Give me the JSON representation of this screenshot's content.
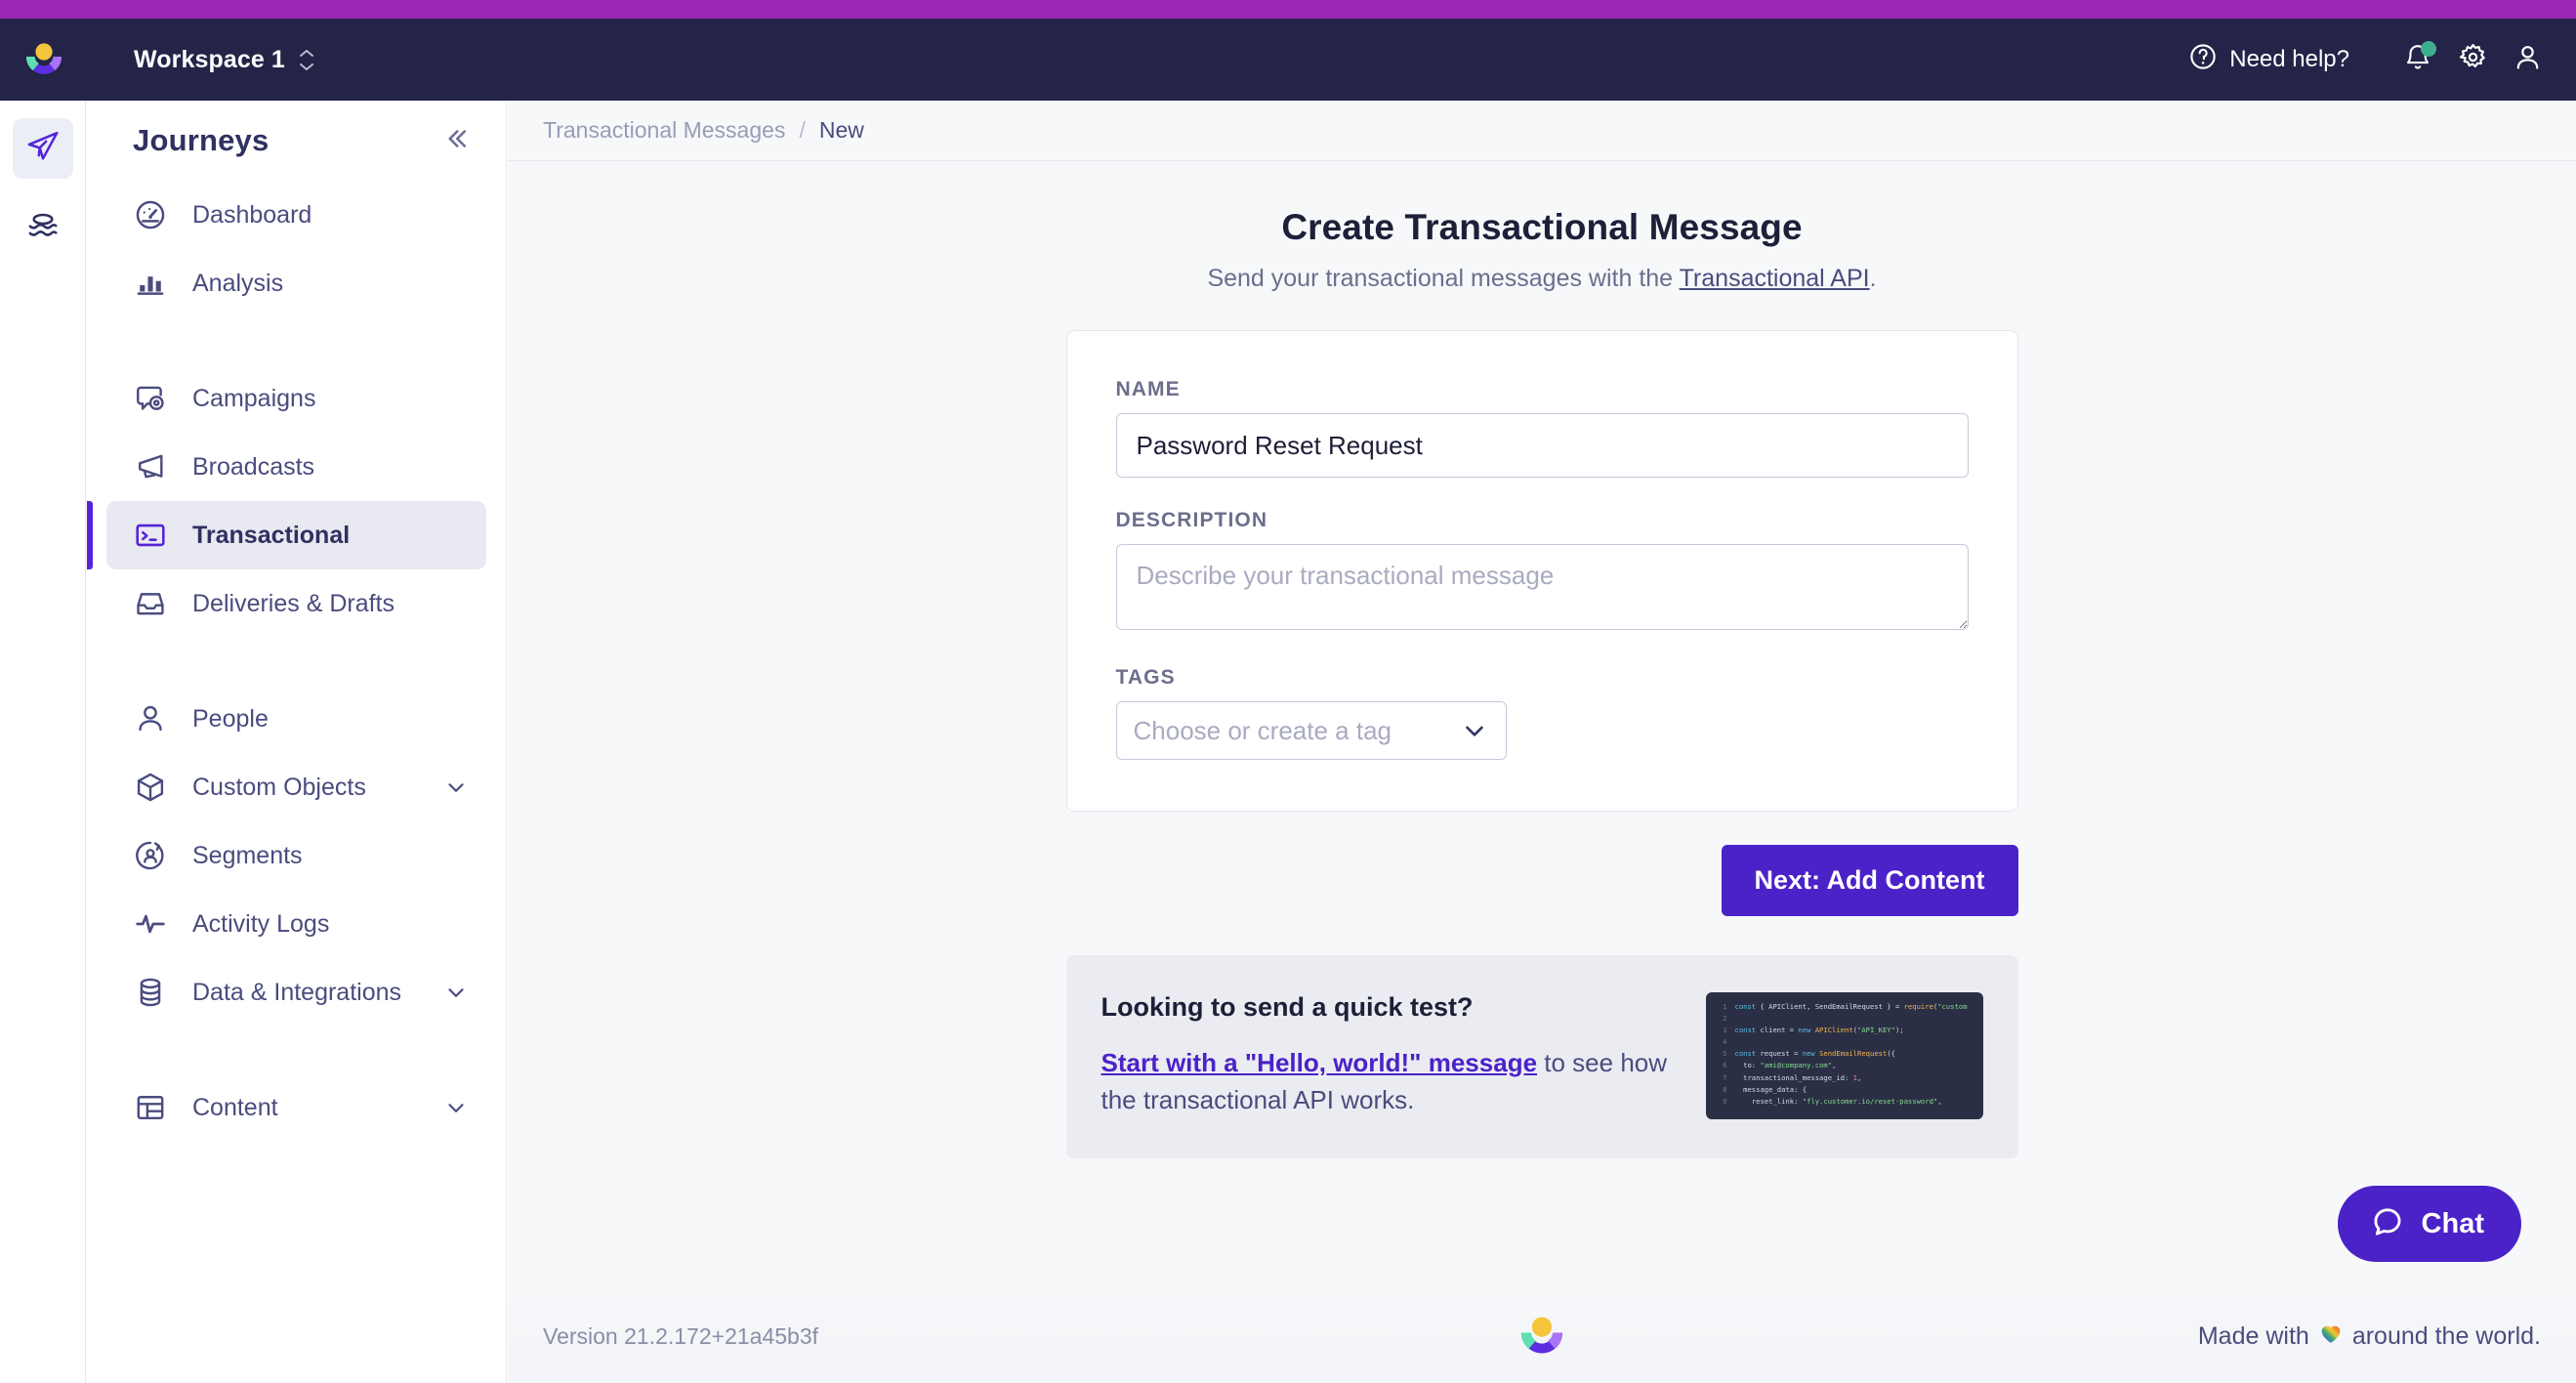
{
  "topbar": {
    "workspace_name": "Workspace 1",
    "need_help_label": "Need help?",
    "icons": {
      "help": "question-circle-icon",
      "bell": "notification-bell-icon",
      "gear": "settings-gear-icon",
      "account": "user-account-icon"
    },
    "notification_dot_color": "#3fae8f",
    "background": "#232447",
    "accent_strip": "#9c27b5"
  },
  "rail": {
    "items": [
      {
        "name": "journeys-rail-icon",
        "active": true
      },
      {
        "name": "data-rail-icon",
        "active": false
      }
    ]
  },
  "sidebar": {
    "title": "Journeys",
    "collapse_icon": "chevron-double-left-icon",
    "groups": [
      {
        "items": [
          {
            "label": "Dashboard",
            "icon": "gauge-icon",
            "active": false,
            "expandable": false
          },
          {
            "label": "Analysis",
            "icon": "bar-chart-icon",
            "active": false,
            "expandable": false
          }
        ]
      },
      {
        "items": [
          {
            "label": "Campaigns",
            "icon": "campaign-bubble-icon",
            "active": false,
            "expandable": false
          },
          {
            "label": "Broadcasts",
            "icon": "megaphone-icon",
            "active": false,
            "expandable": false
          },
          {
            "label": "Transactional",
            "icon": "terminal-icon",
            "active": true,
            "expandable": false
          },
          {
            "label": "Deliveries & Drafts",
            "icon": "inbox-icon",
            "active": false,
            "expandable": false
          }
        ]
      },
      {
        "items": [
          {
            "label": "People",
            "icon": "person-icon",
            "active": false,
            "expandable": false
          },
          {
            "label": "Custom Objects",
            "icon": "cube-icon",
            "active": false,
            "expandable": true
          },
          {
            "label": "Segments",
            "icon": "segment-circle-icon",
            "active": false,
            "expandable": false
          },
          {
            "label": "Activity Logs",
            "icon": "pulse-icon",
            "active": false,
            "expandable": false
          },
          {
            "label": "Data & Integrations",
            "icon": "database-icon",
            "active": false,
            "expandable": true
          }
        ]
      },
      {
        "items": [
          {
            "label": "Content",
            "icon": "layout-table-icon",
            "active": false,
            "expandable": true
          }
        ]
      }
    ],
    "active_accent": "#5523d8"
  },
  "breadcrumb": {
    "parent": "Transactional Messages",
    "separator": "/",
    "current": "New"
  },
  "page": {
    "title": "Create Transactional Message",
    "subtitle_prefix": "Send your transactional messages with the ",
    "subtitle_link": "Transactional API",
    "subtitle_suffix": "."
  },
  "form": {
    "name": {
      "label": "NAME",
      "value": "Password Reset Request",
      "placeholder": ""
    },
    "description": {
      "label": "DESCRIPTION",
      "value": "",
      "placeholder": "Describe your transactional message"
    },
    "tags": {
      "label": "TAGS",
      "selected": "",
      "placeholder": "Choose or create a tag",
      "chevron_icon": "chevron-down-icon"
    },
    "submit_label": "Next: Add Content",
    "submit_color": "#4b22c8"
  },
  "quick_test": {
    "title": "Looking to send a quick test?",
    "link_text": "Start with a \"Hello, world!\" message",
    "body_rest": " to see how the transactional API works.",
    "code_lines": [
      {
        "n": "1",
        "tokens": [
          {
            "t": "const ",
            "c": "kw"
          },
          {
            "t": "{ APIClient, SendEmailRequest } = ",
            "c": "pln"
          },
          {
            "t": "require",
            "c": "fn"
          },
          {
            "t": "(",
            "c": "pln"
          },
          {
            "t": "\"custom",
            "c": "str"
          }
        ]
      },
      {
        "n": "2",
        "tokens": []
      },
      {
        "n": "3",
        "tokens": [
          {
            "t": "const ",
            "c": "kw"
          },
          {
            "t": "client = ",
            "c": "pln"
          },
          {
            "t": "new ",
            "c": "kw"
          },
          {
            "t": "APIClient",
            "c": "fn"
          },
          {
            "t": "(",
            "c": "pln"
          },
          {
            "t": "\"API_KEY\"",
            "c": "str"
          },
          {
            "t": ");",
            "c": "pln"
          }
        ]
      },
      {
        "n": "4",
        "tokens": []
      },
      {
        "n": "5",
        "tokens": [
          {
            "t": "const ",
            "c": "kw"
          },
          {
            "t": "request = ",
            "c": "pln"
          },
          {
            "t": "new ",
            "c": "kw"
          },
          {
            "t": "SendEmailRequest",
            "c": "fn"
          },
          {
            "t": "({",
            "c": "pln"
          }
        ]
      },
      {
        "n": "6",
        "tokens": [
          {
            "t": "  to: ",
            "c": "prp"
          },
          {
            "t": "\"ami@company.com\"",
            "c": "str"
          },
          {
            "t": ",",
            "c": "pln"
          }
        ]
      },
      {
        "n": "7",
        "tokens": [
          {
            "t": "  transactional_message_id: ",
            "c": "prp"
          },
          {
            "t": "1",
            "c": "num"
          },
          {
            "t": ",",
            "c": "pln"
          }
        ]
      },
      {
        "n": "8",
        "tokens": [
          {
            "t": "  message_data: {",
            "c": "prp"
          }
        ]
      },
      {
        "n": "9",
        "tokens": [
          {
            "t": "    reset_link: ",
            "c": "prp"
          },
          {
            "t": "\"fly.customer.io/reset-password\"",
            "c": "str"
          },
          {
            "t": ",",
            "c": "pln"
          }
        ]
      }
    ]
  },
  "footer": {
    "version": "Version 21.2.172+21a45b3f",
    "made_prefix": "Made with ",
    "made_heart": "rainbow-heart-icon",
    "made_suffix": " around the world."
  },
  "chat": {
    "label": "Chat",
    "icon": "chat-bubble-icon"
  }
}
